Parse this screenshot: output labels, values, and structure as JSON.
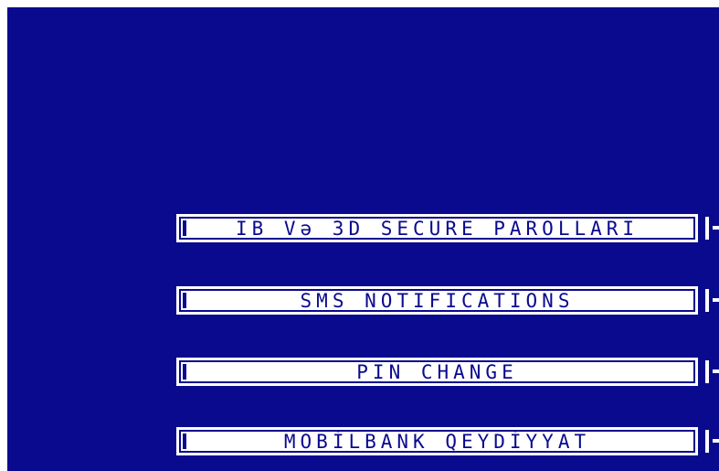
{
  "screen": {
    "background_color": "#0a0a8f",
    "button_color": "#ffffff",
    "text_color": "#0a0a8f"
  },
  "menu": {
    "items": [
      {
        "label": "IB Və 3D SECURE PAROLLARI"
      },
      {
        "label": "SMS NOTIFICATIONS"
      },
      {
        "label": "PIN CHANGE"
      },
      {
        "label": "MOBİLBANK QEYDİYYAT"
      }
    ]
  }
}
